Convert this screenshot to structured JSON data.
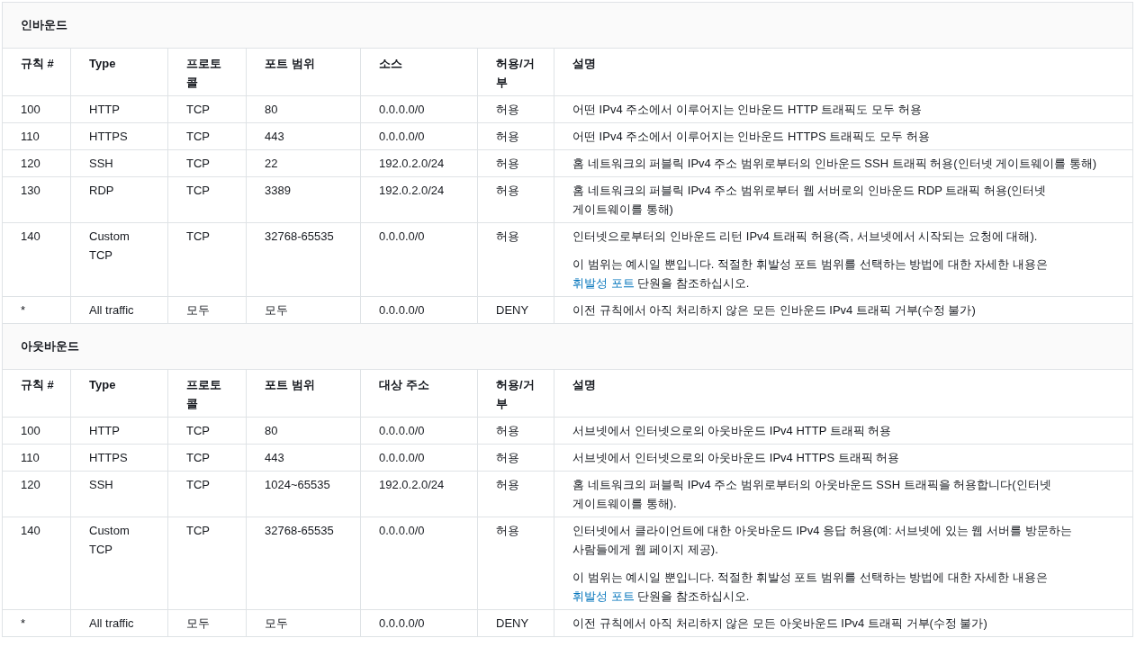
{
  "sections": [
    {
      "title": "인바운드",
      "columns": [
        "규칙 #",
        "Type",
        "프로토콜",
        "포트 범위",
        "소스",
        "허용/거부",
        "설명"
      ],
      "rows": [
        {
          "cells": [
            "100",
            "HTTP",
            "TCP",
            "80",
            "0.0.0.0/0",
            "허용"
          ],
          "description": [
            {
              "text": "어떤 IPv4 주소에서 이루어지는 인바운드 HTTP 트래픽도 모두 허용"
            }
          ]
        },
        {
          "cells": [
            "110",
            "HTTPS",
            "TCP",
            "443",
            "0.0.0.0/0",
            "허용"
          ],
          "description": [
            {
              "text": "어떤 IPv4 주소에서 이루어지는 인바운드 HTTPS 트래픽도 모두 허용"
            }
          ]
        },
        {
          "cells": [
            "120",
            "SSH",
            "TCP",
            "22",
            "192.0.2.0/24",
            "허용"
          ],
          "description": [
            {
              "text": "홈 네트워크의 퍼블릭 IPv4 주소 범위로부터의 인바운드 SSH 트래픽 허용(인터넷 게이트웨이를 통해)"
            }
          ]
        },
        {
          "cells": [
            "130",
            "RDP",
            "TCP",
            "3389",
            "192.0.2.0/24",
            "허용"
          ],
          "description": [
            {
              "text": "홈 네트워크의 퍼블릭 IPv4 주소 범위로부터 웹 서버로의 인바운드 RDP 트래픽 허용(인터넷 게이트웨이를 통해)"
            }
          ]
        },
        {
          "cells": [
            "140",
            "Custom TCP",
            "TCP",
            "32768-65535",
            "0.0.0.0/0",
            "허용"
          ],
          "description": [
            {
              "text": "인터넷으로부터의 인바운드 리턴 IPv4 트래픽 허용(즉, 서브넷에서 시작되는 요청에 대해)."
            },
            {
              "text": "이 범위는 예시일 뿐입니다. 적절한 휘발성 포트 범위를 선택하는 방법에 대한 자세한 내용은 ",
              "link": "휘발성 포트",
              "after": " 단원을 참조하십시오."
            }
          ]
        },
        {
          "cells": [
            "*",
            "All traffic",
            "모두",
            "모두",
            "0.0.0.0/0",
            "DENY"
          ],
          "description": [
            {
              "text": "이전 규칙에서 아직 처리하지 않은 모든 인바운드 IPv4 트래픽 거부(수정 불가)"
            }
          ]
        }
      ]
    },
    {
      "title": "아웃바운드",
      "columns": [
        "규칙 #",
        "Type",
        "프로토콜",
        "포트 범위",
        "대상 주소",
        "허용/거부",
        "설명"
      ],
      "rows": [
        {
          "cells": [
            "100",
            "HTTP",
            "TCP",
            "80",
            "0.0.0.0/0",
            "허용"
          ],
          "description": [
            {
              "text": "서브넷에서 인터넷으로의 아웃바운드 IPv4 HTTP 트래픽 허용"
            }
          ]
        },
        {
          "cells": [
            "110",
            "HTTPS",
            "TCP",
            "443",
            "0.0.0.0/0",
            "허용"
          ],
          "description": [
            {
              "text": "서브넷에서 인터넷으로의 아웃바운드 IPv4 HTTPS 트래픽 허용"
            }
          ]
        },
        {
          "cells": [
            "120",
            "SSH",
            "TCP",
            "1024~65535",
            "192.0.2.0/24",
            "허용"
          ],
          "description": [
            {
              "text": "홈 네트워크의 퍼블릭 IPv4 주소 범위로부터의 아웃바운드 SSH 트래픽을 허용합니다(인터넷 게이트웨이를 통해)."
            }
          ]
        },
        {
          "cells": [
            "140",
            "Custom TCP",
            "TCP",
            "32768-65535",
            "0.0.0.0/0",
            "허용"
          ],
          "description": [
            {
              "text": "인터넷에서 클라이언트에 대한 아웃바운드 IPv4 응답 허용(예: 서브넷에 있는 웹 서버를 방문하는 사람들에게 웹 페이지 제공)."
            },
            {
              "text": "이 범위는 예시일 뿐입니다. 적절한 휘발성 포트 범위를 선택하는 방법에 대한 자세한 내용은 ",
              "link": "휘발성 포트",
              "after": " 단원을 참조하십시오."
            }
          ]
        },
        {
          "cells": [
            "*",
            "All traffic",
            "모두",
            "모두",
            "0.0.0.0/0",
            "DENY"
          ],
          "description": [
            {
              "text": "이전 규칙에서 아직 처리하지 않은 모든 아웃바운드 IPv4 트래픽 거부(수정 불가)"
            }
          ]
        }
      ]
    }
  ]
}
